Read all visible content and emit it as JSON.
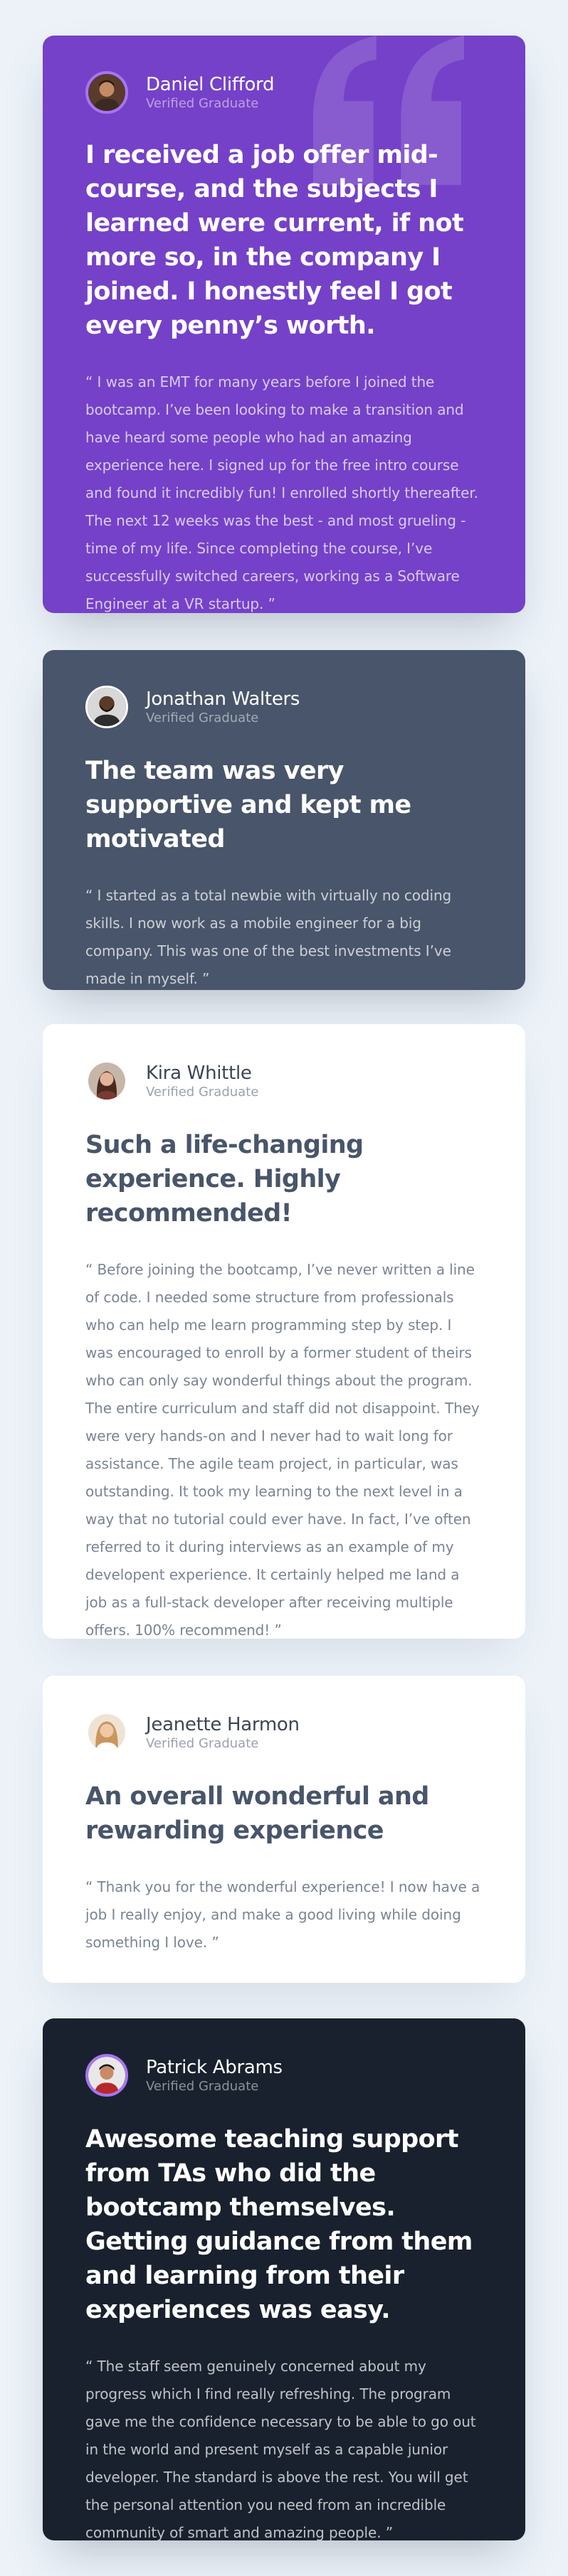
{
  "testimonials": [
    {
      "name": "Daniel Clifford",
      "role": "Verified Graduate",
      "headline": "I received a job offer mid-course, and the subjects I learned were current, if not more so, in the company I joined. I honestly feel I got every penny’s worth.",
      "body": "“ I was an EMT for many years before I joined the bootcamp. I’ve been looking to make a transition and have heard some people who had an amazing experience here. I signed up for the free intro course and found it incredibly fun! I enrolled shortly thereafter. The next 12 weeks was the best - and most grueling - time of my life. Since completing the course, I’ve successfully switched careers, working as a Software Engineer at a VR startup. ”",
      "theme": "violet",
      "color": "#7541c8"
    },
    {
      "name": "Jonathan Walters",
      "role": "Verified Graduate",
      "headline": "The team was very supportive and kept me motivated",
      "body": "“ I started as a total newbie with virtually no coding skills. I now work as a mobile engineer for a big company. This was one of the best investments I’ve made in myself. ”",
      "theme": "slate",
      "color": "#48556a"
    },
    {
      "name": "Kira Whittle",
      "role": "Verified Graduate",
      "headline": "Such a life-changing experience. Highly recommended!",
      "body": "“ Before joining the bootcamp, I’ve never written a line of code. I needed some structure from professionals who can help me learn programming step by step. I was encouraged to enroll by a former student of theirs who can only say wonderful things about the program. The entire curriculum and staff did not disappoint. They were very hands-on and I never had to wait long for assistance. The agile team project, in particular, was outstanding. It took my learning to the next level in a way that no tutorial could ever have. In fact, I’ve often referred to it during interviews as an example of my developent experience. It certainly helped me land a job as a full-stack developer after receiving multiple offers. 100% recommend! ”",
      "theme": "white",
      "color": "#ffffff"
    },
    {
      "name": "Jeanette Harmon",
      "role": "Verified Graduate",
      "headline": "An overall wonderful and rewarding experience",
      "body": "“ Thank you for the wonderful experience! I now have a job I really enjoy, and make a good living while doing something I love. ”",
      "theme": "white",
      "color": "#ffffff"
    },
    {
      "name": "Patrick Abrams",
      "role": "Verified Graduate",
      "headline": "Awesome teaching support from TAs who did the bootcamp themselves. Getting guidance from them and learning from their experiences was easy.",
      "body": "“ The staff seem genuinely concerned about my progress which I find really refreshing. The program gave me the confidence necessary to be able to go out in the world and present myself as a capable junior developer. The standard is above the rest. You will get the personal attention you need from an incredible community of smart and amazing people. ”",
      "theme": "dark",
      "color": "#19212e"
    }
  ],
  "colors": {
    "background": "#ecf2f8",
    "violet": "#7541c8",
    "slate": "#48556a",
    "dark": "#19212e",
    "avatar_ring": "#a775f1"
  },
  "icons": [
    "quotation-mark-icon"
  ]
}
